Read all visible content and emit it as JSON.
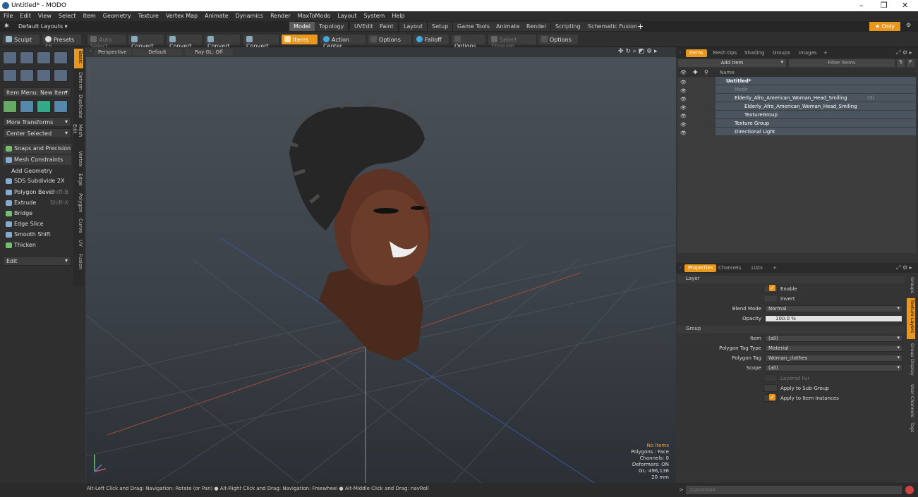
{
  "window": {
    "title": "Untitled* - MODO",
    "controls": [
      "–",
      "❐",
      "✕"
    ]
  },
  "menu": [
    "File",
    "Edit",
    "View",
    "Select",
    "Item",
    "Geometry",
    "Texture",
    "Vertex Map",
    "Animate",
    "Dynamics",
    "Render",
    "MaxToModo",
    "Layout",
    "System",
    "Help"
  ],
  "layout_selector": "Default Layouts ▾",
  "mode_tabs": [
    "Model",
    "Topology",
    "UVEdit",
    "Paint",
    "Layout",
    "Setup",
    "Game Tools",
    "Animate",
    "Render",
    "Scripting",
    "Schematic Fusion",
    "+"
  ],
  "mode_active": "Model",
  "only_label": "★ Only",
  "toolbar": {
    "sculpt": "Sculpt",
    "presets": "Presets",
    "presets_key": "F6",
    "auto_select": "Auto Select",
    "convert": "Convert",
    "items": "Items",
    "action_center": "Action Center",
    "options": "Options",
    "falloff": "Falloff",
    "select_through": "Select Through"
  },
  "left_panel": {
    "item_menu": "Item Menu: New Item",
    "more_transforms": "More Transforms",
    "center_selected": "Center Selected",
    "snaps": "Snaps and Precision",
    "mesh_constraints": "Mesh Constraints",
    "add_geometry": "Add Geometry",
    "tools": [
      {
        "label": "SDS Subdivide 2X",
        "key": ""
      },
      {
        "label": "Polygon Bevel",
        "key": "Shift-B"
      },
      {
        "label": "Extrude",
        "key": "Shift-X"
      },
      {
        "label": "Bridge",
        "key": ""
      },
      {
        "label": "Edge Slice",
        "key": ""
      },
      {
        "label": "Smooth Shift",
        "key": ""
      },
      {
        "label": "Thicken",
        "key": ""
      }
    ],
    "edit": "Edit",
    "side_tabs": [
      "Basic",
      "Deform",
      "Duplicate",
      "Mesh Edit",
      "Vertex",
      "Edge",
      "Polygon",
      "Curve",
      "UV",
      "Fusion"
    ]
  },
  "viewport": {
    "view": "Perspective",
    "shading": "Default",
    "raygl": "Ray GL: Off",
    "stats": [
      "No Items",
      "Polygons : Face",
      "Channels: 0",
      "Deformers: ON",
      "GL: 496,136",
      "20 mm"
    ]
  },
  "status": "Alt-Left Click and Drag: Navigation: Rotate (or Pan) ● Alt-Right Click and Drag: Navigation: Freewheel ● Alt-Middle Click and Drag: navRoll",
  "items_panel": {
    "tabs": [
      "Items",
      "Mesh Ops",
      "Shading",
      "Groups",
      "Images",
      "+"
    ],
    "add_item": "Add Item",
    "filter": "Filter Items",
    "col_name": "Name",
    "tree": [
      {
        "label": "Untitled*",
        "indent": 0
      },
      {
        "label": "Mesh",
        "indent": 1
      },
      {
        "label": "Elderly_Afro_American_Woman_Head_Smiling",
        "suffix": "(3)",
        "indent": 1
      },
      {
        "label": "Elderly_Afro_American_Woman_Head_Smiling",
        "indent": 2
      },
      {
        "label": "TextureGroup",
        "indent": 2
      },
      {
        "label": "Texture Group",
        "indent": 1
      },
      {
        "label": "Directional Light",
        "indent": 1
      }
    ]
  },
  "properties": {
    "tabs": [
      "Properties",
      "Channels",
      "Lists",
      "+"
    ],
    "layer_section": "Layer",
    "enable": "Enable",
    "invert": "Invert",
    "blend_mode_label": "Blend Mode",
    "blend_mode": "Normal",
    "opacity_label": "Opacity",
    "opacity": "100.0 %",
    "group_section": "Group",
    "item_label": "Item",
    "item": "(all)",
    "poly_tag_type_label": "Polygon Tag Type",
    "poly_tag_type": "Material",
    "poly_tag_label": "Polygon Tag",
    "poly_tag": "Woman_clothes",
    "scope_label": "Scope",
    "scope": "(all)",
    "layered_fur": "Layered Fur",
    "apply_sub": "Apply to Sub-Group",
    "apply_inst": "Apply to Item Instances",
    "side_tabs": [
      "Groups",
      "Texture Layers",
      "Group Display",
      "User Channels",
      "Tags"
    ]
  },
  "command_placeholder": "Command"
}
